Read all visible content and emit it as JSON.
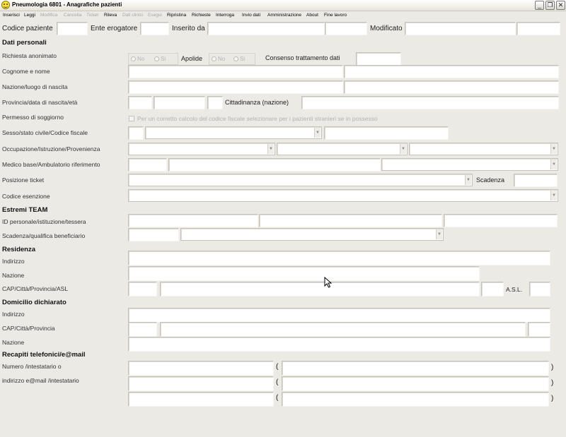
{
  "window": {
    "title": "Pneumologia 6801 - Anagrafiche pazienti",
    "buttons": {
      "minimize": "_",
      "restore": "❐",
      "close": "✕"
    }
  },
  "menu": [
    {
      "label": "Inserisci",
      "enabled": true
    },
    {
      "label": "Leggi",
      "enabled": true
    },
    {
      "label": "Modifica",
      "enabled": false
    },
    {
      "label": "Cancella",
      "enabled": false
    },
    {
      "label": "Ticket",
      "enabled": false
    },
    {
      "label": "Rileva",
      "enabled": true
    },
    {
      "label": "Dati clinici",
      "enabled": false
    },
    {
      "label": "Esegui",
      "enabled": false
    },
    {
      "label": "Ripristina",
      "enabled": true
    },
    {
      "label": "Richieste",
      "enabled": true
    },
    {
      "label": "Interroga",
      "enabled": true
    },
    {
      "label": "Invio dati",
      "enabled": true
    },
    {
      "label": "Amministrazione",
      "enabled": true
    },
    {
      "label": "About",
      "enabled": true
    },
    {
      "label": "Fine lavoro",
      "enabled": true
    }
  ],
  "top_row": {
    "codice_paziente": "Codice paziente",
    "ente_erogatore": "Ente erogatore",
    "inserito_da": "Inserito da",
    "modificato": "Modificato"
  },
  "dati_personali": {
    "header": "Dati personali",
    "richiesta_anonimato": "Richiesta anonimato",
    "radio_no": "No",
    "radio_si": "Si",
    "apolide": "Apolide",
    "consenso": "Consenso trattamento dati",
    "cognome_nome": "Cognome e nome",
    "nazione_luogo": "Nazione/luogo di nascita",
    "provincia_data": "Provincia/data di nascita/età",
    "cittadinanza": "Cittadinanza (nazione)",
    "permesso": "Permesso di soggiorno",
    "permesso_hint": "Per un corretto calcolo del codice fiscale selezionare per i pazienti stranieri se in possesso",
    "sesso_stato": "Sesso/stato civile/Codice fiscale",
    "occupazione": "Occupazione/Istruzione/Provenienza",
    "medico_base": "Medico base/Ambulatorio riferimento",
    "posizione_ticket": "Posizione ticket",
    "scadenza": "Scadenza",
    "codice_esenzione": "Codice esenzione"
  },
  "estremi_team": {
    "header": "Estremi TEAM",
    "id_personale": "ID personale/istituzione/tessera",
    "scadenza_qualifica": "Scadenza/qualifica beneficiario"
  },
  "residenza": {
    "header": "Residenza",
    "indirizzo": "Indirizzo",
    "nazione": "Nazione",
    "cap_citta": "CAP/Città/Provincia/ASL",
    "asl": "A.S.L."
  },
  "domicilio": {
    "header": "Domicilio dichiarato",
    "indirizzo": "Indirizzo",
    "cap_citta": "CAP/Città/Provincia",
    "nazione": "Nazione"
  },
  "recapiti": {
    "header": "Recapiti telefonici/e@mail",
    "numero": "Numero /intestatario o",
    "email": "indirizzo e@mail /intestatario",
    "paren_open": "(",
    "paren_close": ")"
  },
  "icons": {
    "combo_arrow": "▼",
    "app_icon": "smiley-icon",
    "cursor": "mouse-cursor-icon"
  }
}
